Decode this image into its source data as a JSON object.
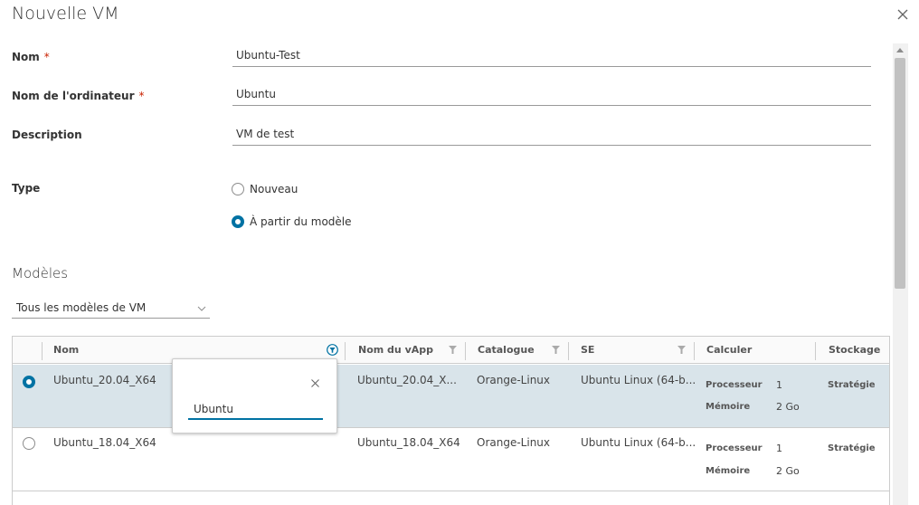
{
  "dialog": {
    "title": "Nouvelle VM",
    "close_icon": "close-icon"
  },
  "form": {
    "name_label": "Nom",
    "name_required": "*",
    "name_value": "Ubuntu-Test",
    "computer_label": "Nom de l'ordinateur",
    "computer_required": "*",
    "computer_value": "Ubuntu",
    "description_label": "Description",
    "description_value": "VM de test",
    "type_label": "Type",
    "type_options": [
      {
        "label": "Nouveau",
        "selected": false
      },
      {
        "label": "À partir du modèle",
        "selected": true
      }
    ]
  },
  "templates": {
    "section_title": "Modèles",
    "filter_select": "Tous les modèles de VM",
    "columns": [
      "Nom",
      "Nom du vApp",
      "Catalogue",
      "SE",
      "Calculer",
      "Stockage"
    ],
    "rows": [
      {
        "selected": true,
        "name": "Ubuntu_20.04_X64",
        "vapp": "Ubuntu_20.04_X...",
        "catalog": "Orange-Linux",
        "os": "Ubuntu Linux (64-b...",
        "cpu_label": "Processeur",
        "cpu": "1",
        "mem_label": "Mémoire",
        "mem": "2 Go",
        "storage": "Stratégie"
      },
      {
        "selected": false,
        "name": "Ubuntu_18.04_X64",
        "vapp": "Ubuntu_18.04_X64",
        "catalog": "Orange-Linux",
        "os": "Ubuntu Linux (64-b...",
        "cpu_label": "Processeur",
        "cpu": "1",
        "mem_label": "Mémoire",
        "mem": "2 Go",
        "storage": "Stratégie"
      }
    ],
    "name_filter": {
      "value": "Ubuntu",
      "active": true
    }
  },
  "colors": {
    "accent": "#0072a3",
    "selected_row": "#d9e4ea",
    "required": "#c92100"
  }
}
